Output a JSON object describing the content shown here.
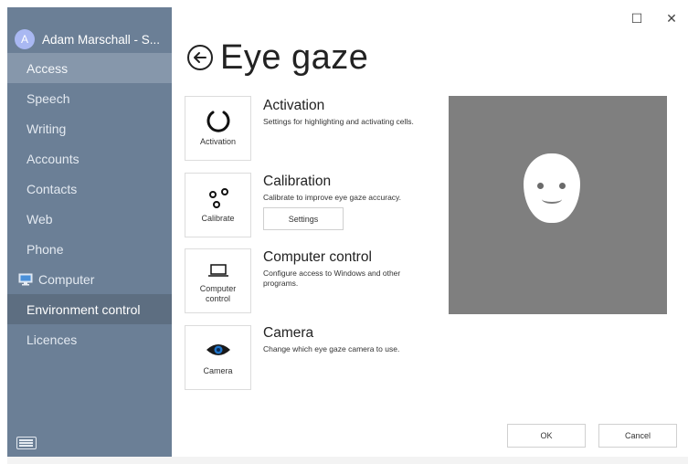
{
  "window": {
    "maximize_symbol": "☐",
    "close_symbol": "✕"
  },
  "sidebar": {
    "user": {
      "initial": "A",
      "name": "Adam Marschall - S..."
    },
    "items": [
      {
        "label": "Access",
        "state": "selected"
      },
      {
        "label": "Speech"
      },
      {
        "label": "Writing"
      },
      {
        "label": "Accounts"
      },
      {
        "label": "Contacts"
      },
      {
        "label": "Web"
      },
      {
        "label": "Phone"
      },
      {
        "label": "Computer",
        "icon": "computer-monitor-icon"
      },
      {
        "label": "Environment control",
        "state": "hover"
      },
      {
        "label": "Licences"
      }
    ],
    "bottom_icon": "keyboard-icon"
  },
  "page": {
    "title": "Eye gaze",
    "back_icon": "back-arrow-icon"
  },
  "tiles": [
    {
      "label": "Activation",
      "icon": "activation-arc-icon"
    },
    {
      "label": "Calibrate",
      "icon": "calibration-dots-icon"
    },
    {
      "label_line1": "Computer",
      "label_line2": "control",
      "icon": "laptop-icon"
    },
    {
      "label": "Camera",
      "icon": "eye-icon"
    }
  ],
  "sections": [
    {
      "title": "Activation",
      "desc": "Settings for highlighting and activating cells."
    },
    {
      "title": "Calibration",
      "desc": "Calibrate to improve eye gaze accuracy.",
      "button": "Settings"
    },
    {
      "title": "Computer control",
      "desc": "Configure access to Windows and other programs."
    },
    {
      "title": "Camera",
      "desc": "Change which eye gaze camera to use."
    }
  ],
  "preview": {
    "icon": "face-icon",
    "colors": {
      "background": "#7f7f7f",
      "face": "#ffffff"
    }
  },
  "footer": {
    "ok": "OK",
    "cancel": "Cancel"
  },
  "colors": {
    "sidebar": "#6b7f96",
    "selected": "#8697ab",
    "hover": "#5d6e81"
  }
}
